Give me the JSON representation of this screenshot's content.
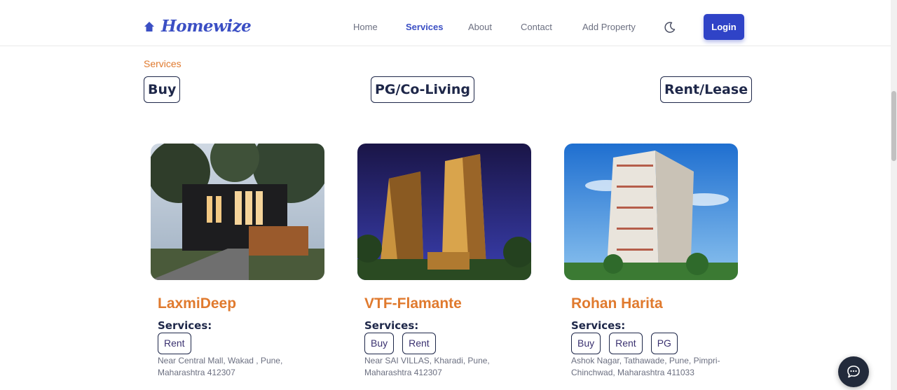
{
  "header": {
    "brand": "Homewize",
    "nav": [
      {
        "label": "Home",
        "active": false
      },
      {
        "label": "Services",
        "active": true
      },
      {
        "label": "About",
        "active": false
      },
      {
        "label": "Contact",
        "active": false
      },
      {
        "label": "Add Property",
        "active": false
      }
    ],
    "theme_icon": "moon-icon",
    "login_label": "Login"
  },
  "page": {
    "section_label": "Services",
    "filters": [
      "Buy",
      "PG/Co-Living",
      "Rent/Lease"
    ]
  },
  "cards": [
    {
      "title": "LaxmiDeep",
      "services_label": "Services:",
      "tags": [
        "Rent"
      ],
      "address": "Near Central Mall, Wakad , Pune, Maharashtra 412307"
    },
    {
      "title": "VTF-Flamante",
      "services_label": "Services:",
      "tags": [
        "Buy",
        "Rent"
      ],
      "address": "Near SAI VILLAS, Kharadi, Pune, Maharashtra 412307"
    },
    {
      "title": "Rohan Harita",
      "services_label": "Services:",
      "tags": [
        "Buy",
        "Rent",
        "PG"
      ],
      "address": "Ashok Nagar, Tathawade, Pune, Pimpri-Chinchwad, Maharashtra 411033"
    }
  ],
  "chat_icon": "chat-bubble-icon",
  "colors": {
    "accent": "#2f43c7",
    "brand": "#3b4fc4",
    "title_orange": "#e07a2e",
    "dark_navy": "#1e2749"
  }
}
